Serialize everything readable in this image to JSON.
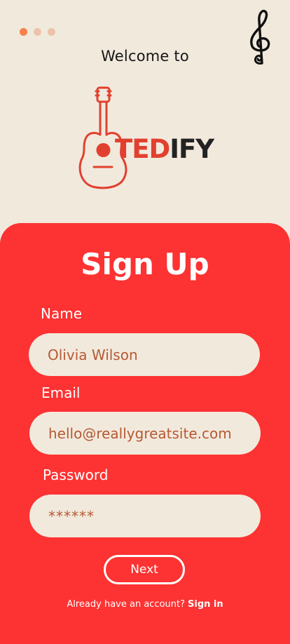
{
  "theme": {
    "background": "#f2e9dd",
    "accent": "#fd3232",
    "field_bg": "#f2e9dd",
    "field_text": "#b55a32",
    "dot_active": "#f77f4a",
    "dot_inactive": "#ecc2aa",
    "brand_ted_color": "#e2402f",
    "brand_ify_color": "#232323"
  },
  "header": {
    "welcome": "Welcome to",
    "brand_part1": "TED",
    "brand_part2": "IFY",
    "icons": [
      "treble-clef-icon",
      "guitar-icon"
    ]
  },
  "pager": {
    "total": 3,
    "active": 1
  },
  "form": {
    "title": "Sign Up",
    "name_label": "Name",
    "name_value": "Olivia Wilson",
    "email_label": "Email",
    "email_value": "hello@reallygreatsite.com",
    "password_label": "Password",
    "password_value": "******",
    "next_label": "Next"
  },
  "footer": {
    "prompt": "Already have an account?",
    "link": "Sign in"
  }
}
